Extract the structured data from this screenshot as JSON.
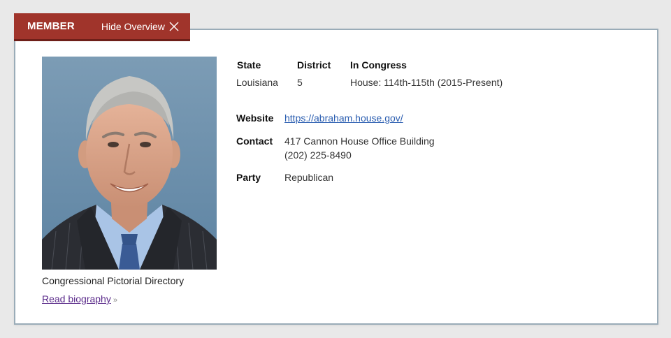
{
  "tab": {
    "title": "MEMBER",
    "toggle_label": "Hide Overview"
  },
  "photo": {
    "caption": "Congressional Pictorial Directory",
    "bio_link": "Read biography",
    "bio_chevron": "»"
  },
  "summary": {
    "state_label": "State",
    "state_value": "Louisiana",
    "district_label": "District",
    "district_value": "5",
    "congress_label": "In Congress",
    "congress_value": "House: 114th-115th (2015-Present)"
  },
  "details": {
    "website_label": "Website",
    "website_value": "https://abraham.house.gov/",
    "contact_label": "Contact",
    "contact_address": "417 Cannon House Office Building",
    "contact_phone": "(202) 225-8490",
    "party_label": "Party",
    "party_value": "Republican"
  },
  "colors": {
    "tab_bg": "#a0342b",
    "link": "#2a5db0",
    "visited_link": "#5a2a8a",
    "panel_border": "#9aacb8"
  }
}
